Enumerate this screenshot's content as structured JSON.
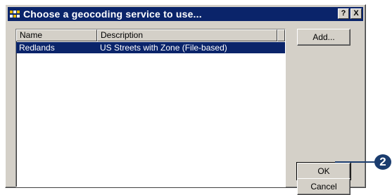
{
  "dialog": {
    "title": "Choose a geocoding service to use...",
    "help_button": "?",
    "close_button": "X"
  },
  "list": {
    "columns": [
      "Name",
      "Description"
    ],
    "rows": [
      {
        "name": "Redlands",
        "description": "US Streets with Zone (File-based)",
        "selected": true
      }
    ]
  },
  "buttons": {
    "add": "Add...",
    "ok": "OK",
    "cancel": "Cancel"
  },
  "callout": {
    "number": "2",
    "color": "#1a3c6e"
  },
  "colors": {
    "titlebar": "#0a246a",
    "selection": "#0a246a",
    "face": "#d4d0c8"
  }
}
